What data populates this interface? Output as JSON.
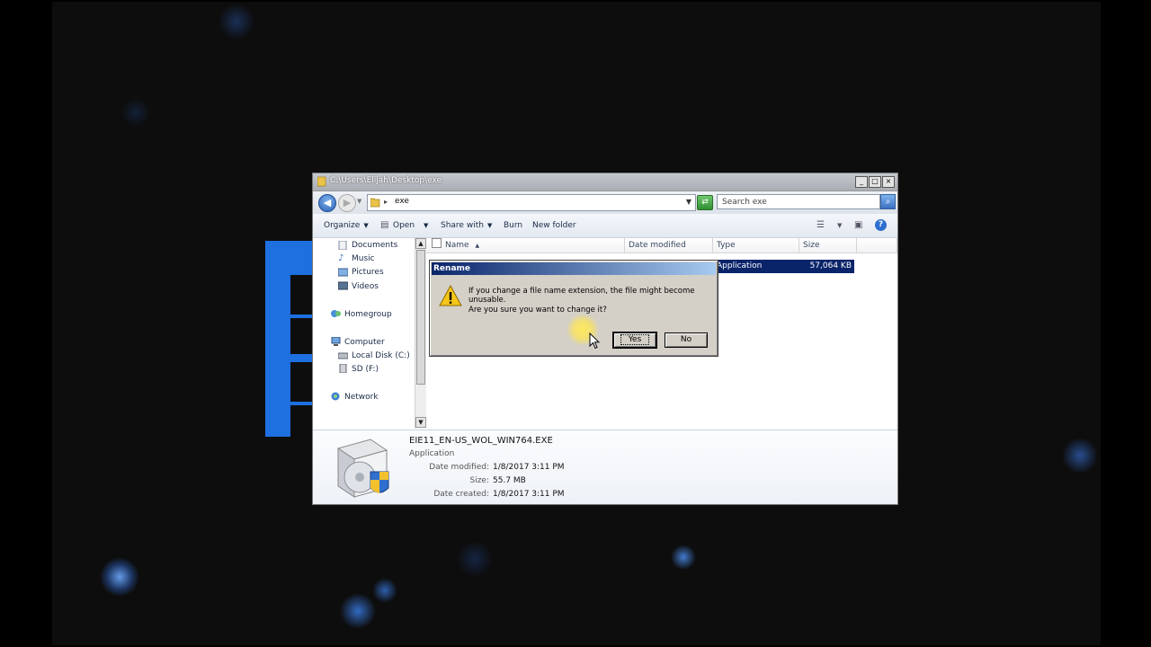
{
  "window": {
    "title": "C:\\Users\\Elijah\\Desktop\\exe",
    "controls": {
      "minimize": "_",
      "maximize": "□",
      "close": "×"
    }
  },
  "address": {
    "path": "exe",
    "search_placeholder": "Search exe"
  },
  "toolbar": {
    "organize": "Organize",
    "open": "Open",
    "share_with": "Share with",
    "burn": "Burn",
    "new_folder": "New folder"
  },
  "nav": {
    "documents": "Documents",
    "music": "Music",
    "pictures": "Pictures",
    "videos": "Videos",
    "homegroup": "Homegroup",
    "computer": "Computer",
    "local_disk": "Local Disk (C:)",
    "sd": "SD (F:)",
    "network": "Network"
  },
  "columns": {
    "name": "Name",
    "date_modified": "Date modified",
    "type": "Type",
    "size": "Size"
  },
  "selected_row": {
    "type": "Application",
    "size": "57,064 KB"
  },
  "details": {
    "filename": "EIE11_EN-US_WOL_WIN764.EXE",
    "filetype": "Application",
    "date_modified_label": "Date modified:",
    "date_modified": "1/8/2017 3:11 PM",
    "size_label": "Size:",
    "size": "55.7 MB",
    "date_created_label": "Date created:",
    "date_created": "1/8/2017 3:11 PM"
  },
  "dialog": {
    "title": "Rename",
    "message": "If you change a file name extension, the file might become unusable.",
    "question": "Are you sure you want to change it?",
    "yes": "Yes",
    "no": "No"
  },
  "colors": {
    "selection": "#0a246a",
    "dialog_bg": "#d4d0c8",
    "accent_blue": "#1e6fe0"
  }
}
